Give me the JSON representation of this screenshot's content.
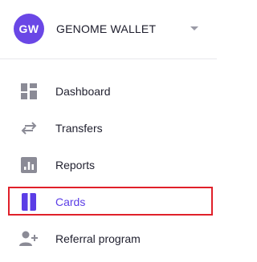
{
  "account": {
    "initials": "GW",
    "name": "GENOME WALLET",
    "avatar_color": "#6a47e6"
  },
  "nav": {
    "items": [
      {
        "label": "Dashboard",
        "icon": "dashboard-icon"
      },
      {
        "label": "Transfers",
        "icon": "transfer-arrows-icon"
      },
      {
        "label": "Reports",
        "icon": "bar-chart-icon"
      },
      {
        "label": "Cards",
        "icon": "card-icon",
        "active": true
      },
      {
        "label": "Referral program",
        "icon": "add-user-icon"
      }
    ]
  },
  "colors": {
    "accent": "#5b3de6",
    "icon_gray": "#8b8b96",
    "highlight_border": "#e0202a"
  }
}
